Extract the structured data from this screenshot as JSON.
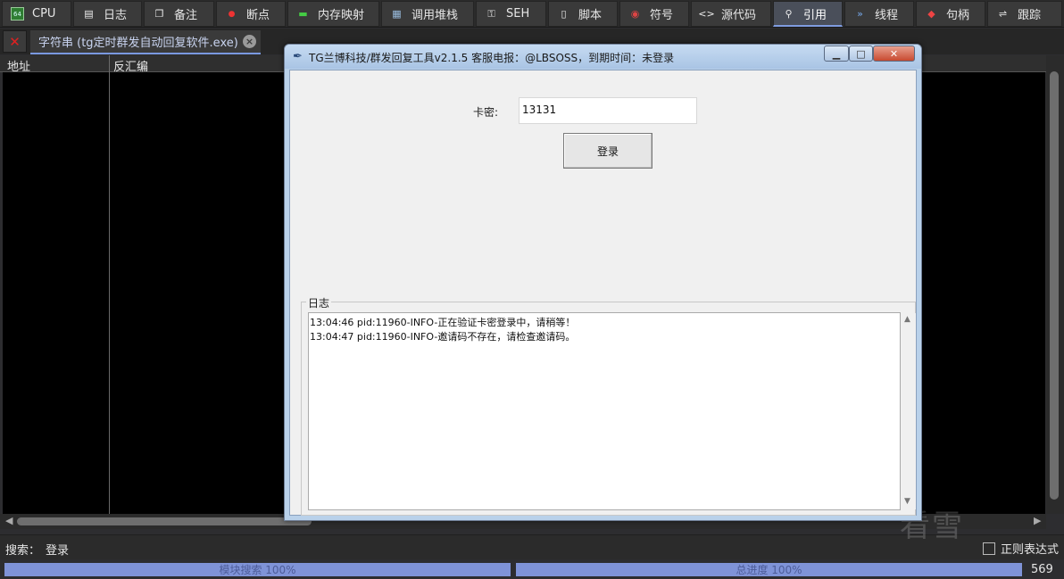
{
  "toolbar": {
    "tabs": [
      {
        "label": "CPU",
        "icon": "cpu-icon"
      },
      {
        "label": "日志",
        "icon": "log-icon"
      },
      {
        "label": "备注",
        "icon": "notes-icon"
      },
      {
        "label": "断点",
        "icon": "breakpoint-icon"
      },
      {
        "label": "内存映射",
        "icon": "memory-map-icon"
      },
      {
        "label": "调用堆栈",
        "icon": "call-stack-icon"
      },
      {
        "label": "SEH",
        "icon": "seh-icon"
      },
      {
        "label": "脚本",
        "icon": "script-icon"
      },
      {
        "label": "符号",
        "icon": "symbol-icon"
      },
      {
        "label": "源代码",
        "icon": "source-icon"
      },
      {
        "label": "引用",
        "icon": "references-icon"
      },
      {
        "label": "线程",
        "icon": "threads-icon"
      },
      {
        "label": "句柄",
        "icon": "handles-icon"
      },
      {
        "label": "跟踪",
        "icon": "trace-icon"
      }
    ],
    "active": "引用"
  },
  "tabbar": {
    "tab_label": "字符串 (tg定时群发自动回复软件.exe)"
  },
  "table": {
    "columns": [
      "地址",
      "反汇编"
    ]
  },
  "dialog": {
    "title": "TG兰博科技/群发回复工具v2.1.5    客服电报：@LBSOSS，到期时间：未登录",
    "card_label": "卡密:",
    "card_value": "13131",
    "login_button": "登录",
    "log_group_title": "日志",
    "log_lines": [
      "13:04:46 pid:11960-INFO-正在验证卡密登录中，请稍等！",
      "13:04:47 pid:11960-INFO-邀请码不存在，请检查邀请码。"
    ]
  },
  "search": {
    "label": "搜索：",
    "value": "登录",
    "regex_label": "正则表达式"
  },
  "status": {
    "module_progress": "模块搜索 100%",
    "total_progress": "总进度 100%",
    "count": "569"
  },
  "watermark": "看雪",
  "colors": {
    "accent": "#7f93d8",
    "close_red": "#e02020",
    "background": "#2d2d30"
  }
}
